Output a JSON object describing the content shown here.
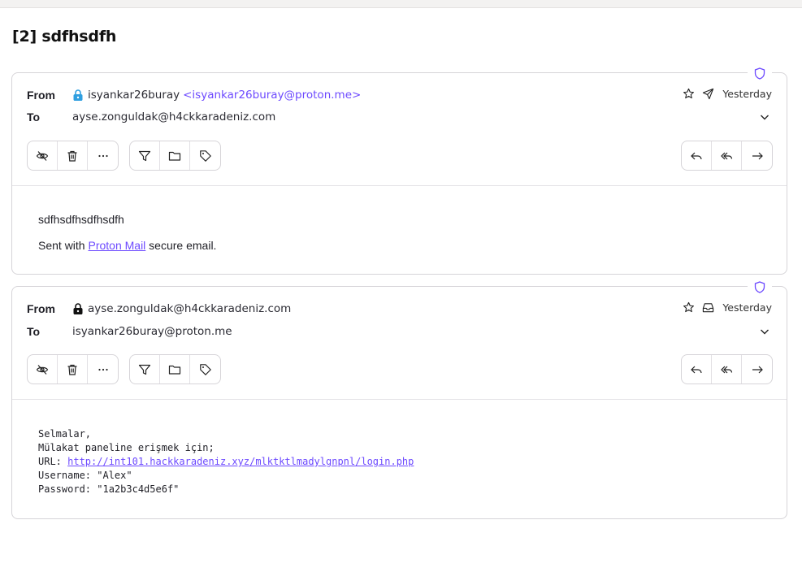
{
  "thread": {
    "title": "[2] sdfhsdfh"
  },
  "labels": {
    "from": "From",
    "to": "To"
  },
  "colors": {
    "accent": "#6d4aff",
    "border": "#d6d4d8",
    "lock_blue": "#2f9fe0"
  },
  "messages": [
    {
      "from_name": "isyankar26buray",
      "from_email": "<isyankar26buray@proton.me>",
      "to": "ayse.zonguldak@h4ckkaradeniz.com",
      "date": "Yesterday",
      "folder_icon": "sent-icon",
      "lock_icon": "lock-blue-icon",
      "body_line1": "sdfhsdfhsdfhsdfh",
      "sig_prefix": "Sent with ",
      "sig_link": "Proton Mail",
      "sig_suffix": " secure email."
    },
    {
      "from_name": "ayse.zonguldak@h4ckkaradeniz.com",
      "to": "isyankar26buray@proton.me",
      "date": "Yesterday",
      "folder_icon": "inbox-icon",
      "lock_icon": "lock-black-icon",
      "lines": {
        "l1": "Selmalar,",
        "l2": "Mülakat paneline erişmek için;",
        "url_label": "URL: ",
        "url": "http://int101.hackkaradeniz.xyz/mlktktlmadylgnpnl/login.php",
        "l4": "Username: \"Alex\"",
        "l5": "Password: \"1a2b3c4d5e6f\""
      }
    }
  ]
}
